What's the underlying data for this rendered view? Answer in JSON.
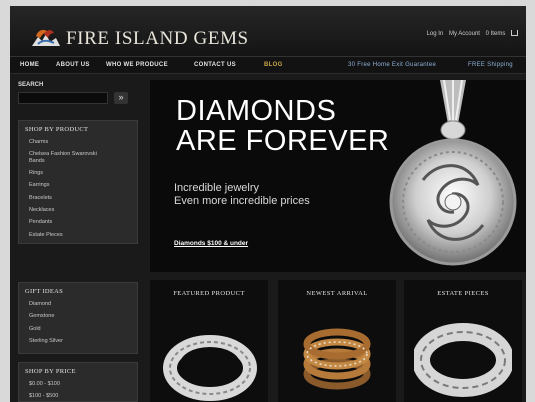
{
  "header": {
    "logo_text": "FIRE ISLAND GEMS",
    "account_links": [
      "Log In",
      "My Account",
      "0 Items"
    ]
  },
  "nav": {
    "items": [
      "HOME",
      "ABOUT US",
      "WHO WE PRODUCE",
      "CONTACT US"
    ],
    "blog": "BLOG",
    "promo_left": "30 Free Home Exit Guarantee",
    "promo_right": "FREE Shipping"
  },
  "sidebar": {
    "search_label": "SEARCH",
    "search_placeholder": "",
    "search_button": "»",
    "shop_panel": {
      "title": "SHOP BY PRODUCT",
      "items": [
        "Charms",
        "Chelsea Fashion Swarovski Bands",
        "Rings",
        "Earrings",
        "Bracelets",
        "Necklaces",
        "Pendants",
        "Estate Pieces"
      ]
    },
    "gift_panel": {
      "title": "GIFT IDEAS",
      "items": [
        "Diamond",
        "Gemstone",
        "Gold",
        "Sterling Silver"
      ]
    },
    "price_panel": {
      "title": "SHOP BY PRICE",
      "items": [
        "$0.00 - $100",
        "$100 - $500"
      ]
    }
  },
  "hero": {
    "title_line1": "DIAMONDS",
    "title_line2": "ARE FOREVER",
    "sub_line1": "Incredible jewelry",
    "sub_line2": "Even more incredible prices",
    "link": "Diamonds $100 & under"
  },
  "tiles": [
    {
      "title": "FEATURED PRODUCT"
    },
    {
      "title": "NEWEST ARRIVAL"
    },
    {
      "title": "ESTATE PIECES"
    }
  ],
  "colors": {
    "background": "#1a1a1a",
    "accent_gold": "#c9a64a",
    "promo_blue": "#8fb3d9"
  }
}
